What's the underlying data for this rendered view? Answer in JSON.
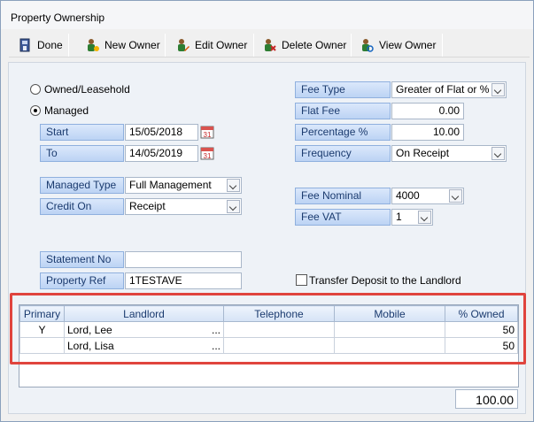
{
  "window": {
    "title": "Property Ownership"
  },
  "toolbar": {
    "done": {
      "label": "Done",
      "icon": "done-icon"
    },
    "new_owner": {
      "label": "New Owner",
      "icon": "new-owner-icon"
    },
    "edit_owner": {
      "label": "Edit Owner",
      "icon": "edit-owner-icon"
    },
    "delete_owner": {
      "label": "Delete Owner",
      "icon": "delete-owner-icon"
    },
    "view_owner": {
      "label": "View Owner",
      "icon": "view-owner-icon"
    }
  },
  "ownership": {
    "owned_label": "Owned/Leasehold",
    "managed_label": "Managed",
    "selected": "Managed"
  },
  "dates": {
    "start_label": "Start",
    "start_value": "15/05/2018",
    "to_label": "To",
    "to_value": "14/05/2019"
  },
  "managed_type": {
    "label": "Managed Type",
    "value": "Full Management"
  },
  "credit_on": {
    "label": "Credit On",
    "value": "Receipt"
  },
  "statement_no": {
    "label": "Statement No",
    "value": ""
  },
  "property_ref": {
    "label": "Property Ref",
    "value": "1TESTAVE"
  },
  "fee_type": {
    "label": "Fee Type",
    "value": "Greater of Flat or %"
  },
  "flat_fee": {
    "label": "Flat Fee",
    "value": "0.00"
  },
  "percentage": {
    "label": "Percentage %",
    "value": "10.00"
  },
  "frequency": {
    "label": "Frequency",
    "value": "On Receipt"
  },
  "fee_nominal": {
    "label": "Fee Nominal",
    "value": "4000"
  },
  "fee_vat": {
    "label": "Fee VAT",
    "value": "1"
  },
  "transfer_deposit": {
    "label": "Transfer Deposit to the Landlord",
    "checked": false
  },
  "grid": {
    "columns": [
      "Primary",
      "Landlord",
      "Telephone",
      "Mobile",
      "% Owned"
    ],
    "rows": [
      {
        "primary": "Y",
        "landlord": "Lord, Lee",
        "ellipsis": "...",
        "telephone": "",
        "mobile": "",
        "owned": "50"
      },
      {
        "primary": "",
        "landlord": "Lord, Lisa",
        "ellipsis": "...",
        "telephone": "",
        "mobile": "",
        "owned": "50"
      }
    ]
  },
  "total": "100.00",
  "colors": {
    "label_bg": "#bcd3f4",
    "label_text": "#1b3b6f",
    "highlight": "#e0443d"
  }
}
